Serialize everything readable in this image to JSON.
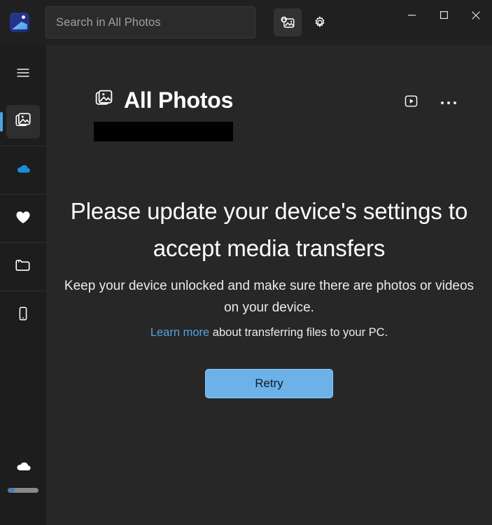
{
  "window": {
    "app_icon": "photos-app-icon",
    "controls": {
      "minimize": "minimize-icon",
      "maximize": "maximize-icon",
      "close": "close-icon"
    }
  },
  "search": {
    "placeholder": "Search in All Photos",
    "value": ""
  },
  "titlebar_actions": [
    {
      "name": "import-photos-icon",
      "label": "Import",
      "hovered": true
    },
    {
      "name": "settings-gear-icon",
      "label": "Settings",
      "hovered": false
    }
  ],
  "sidebar": {
    "menu_icon": "hamburger-menu-icon",
    "items": [
      {
        "icon": "photos-icon",
        "label": "All Photos",
        "selected": true
      },
      {
        "icon": "onedrive-cloud-icon",
        "label": "OneDrive",
        "selected": false
      },
      {
        "icon": "heart-icon",
        "label": "Favorites",
        "selected": false
      },
      {
        "icon": "folder-icon",
        "label": "Folders",
        "selected": false
      },
      {
        "icon": "phone-icon",
        "label": "Phone",
        "selected": false
      }
    ],
    "storage": {
      "icon": "cloud-storage-icon",
      "progress_percent": 22,
      "fill_color": "#4d7fad",
      "track_color": "#8a8a8a"
    },
    "selection_indicator_color": "#4aa3e8"
  },
  "main": {
    "header": {
      "icon": "photos-icon",
      "title": "All Photos",
      "slideshow_icon": "slideshow-play-icon",
      "more_icon": "more-options-icon"
    },
    "redacted_bar": "",
    "empty_state": {
      "title": "Please update your device's settings to accept media transfers",
      "subtitle": "Keep your device unlocked and make sure there are photos or videos on your device.",
      "link_text": "Learn more",
      "link_suffix": " about transferring files to your PC.",
      "button_label": "Retry",
      "button_color": "#6cb2e8"
    }
  }
}
